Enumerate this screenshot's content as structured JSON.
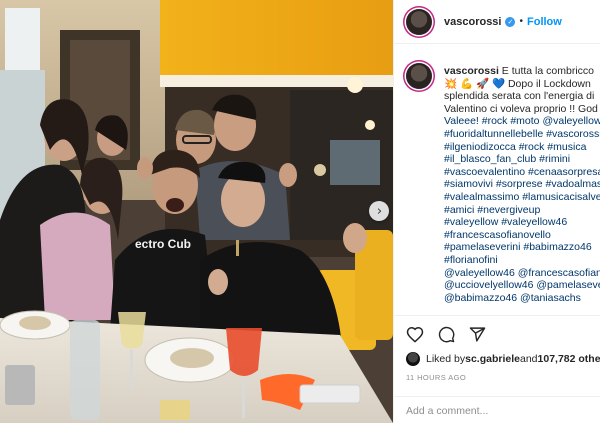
{
  "photo": {
    "alt_icon": "photo-of-group-at-restaurant",
    "shirt_text": "ectro Cub",
    "next_icon": "chevron-right-icon",
    "next_glyph": "›"
  },
  "header": {
    "username": "vascorossi",
    "verified_glyph": "✓",
    "dot": "•",
    "follow_label": "Follow"
  },
  "caption": {
    "username": "vascorossi",
    "lines": [
      " E tutta la combricco",
      "💥 💪 🚀 💙  Dopo il Lockdown",
      "splendida serata con l'energia di",
      "Valentino ci voleva proprio !! God B",
      "Valeee! #rock #moto @valeyellow4",
      "#fuoridaltunnellebelle #vascorossi",
      "#ilgeniodizocca #rock #musica",
      "#il_blasco_fan_club #rimini",
      "#vascoevalentino #cenaasorpresa",
      "#siamovivi #sorprese #vadoalmas",
      "#valealmassimo #lamusicacisalver",
      "#amici #nevergiveup",
      "#valeyellow #valeyellow46",
      "#francescasofianovello",
      "#pamelaseverini #babimazzo46",
      "#florianofini",
      "@valeyellow46 @francescasofiano",
      "@ucciovelyellow46 @pamelaseverini",
      "@babimazzo46 @taniasachs"
    ]
  },
  "actions": {
    "like_icon": "heart-icon",
    "comment_icon": "comment-icon",
    "share_icon": "share-icon",
    "liked_prefix": "Liked by ",
    "liked_user": "sc.gabriele",
    "liked_and": " and ",
    "liked_count": "107,782 othe",
    "time": "11 HOURS AGO",
    "comment_placeholder": "Add a comment..."
  }
}
